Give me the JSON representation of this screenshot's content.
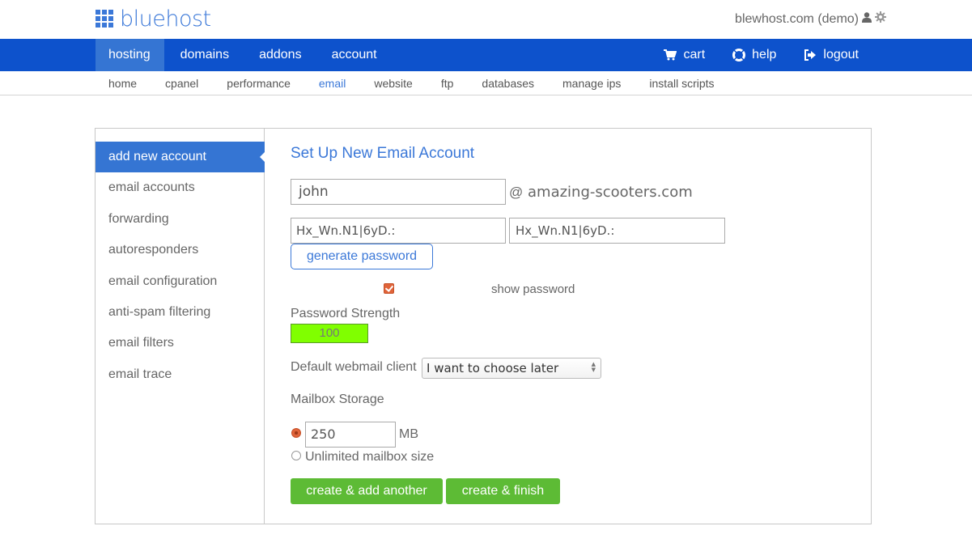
{
  "header": {
    "logo_text": "bluehost",
    "account_label": "blewhost.com (demo)",
    "icons": [
      "user-icon",
      "gear-icon"
    ]
  },
  "primary_nav": {
    "items": [
      {
        "label": "hosting",
        "active": true
      },
      {
        "label": "domains",
        "active": false
      },
      {
        "label": "addons",
        "active": false
      },
      {
        "label": "account",
        "active": false
      }
    ],
    "right_items": [
      {
        "label": "cart",
        "icon": "cart-icon"
      },
      {
        "label": "help",
        "icon": "lifebuoy-icon"
      },
      {
        "label": "logout",
        "icon": "logout-icon"
      }
    ]
  },
  "secondary_nav": {
    "items": [
      {
        "label": "home",
        "active": false
      },
      {
        "label": "cpanel",
        "active": false
      },
      {
        "label": "performance",
        "active": false
      },
      {
        "label": "email",
        "active": true
      },
      {
        "label": "website",
        "active": false
      },
      {
        "label": "ftp",
        "active": false
      },
      {
        "label": "databases",
        "active": false
      },
      {
        "label": "manage ips",
        "active": false
      },
      {
        "label": "install scripts",
        "active": false
      }
    ]
  },
  "sidebar": {
    "items": [
      {
        "label": "add new account",
        "active": true
      },
      {
        "label": "email accounts",
        "active": false
      },
      {
        "label": "forwarding",
        "active": false
      },
      {
        "label": "autoresponders",
        "active": false
      },
      {
        "label": "email configuration",
        "active": false
      },
      {
        "label": "anti-spam filtering",
        "active": false
      },
      {
        "label": "email filters",
        "active": false
      },
      {
        "label": "email trace",
        "active": false
      }
    ]
  },
  "form": {
    "title": "Set Up New Email Account",
    "email_user": "john",
    "at_sign": "@",
    "email_domain": "amazing-scooters.com",
    "password": "Hx_Wn.N1|6yD.:",
    "password_confirm": "Hx_Wn.N1|6yD.:",
    "generate_password_label": "generate password",
    "show_password_label": "show password",
    "show_password_checked": true,
    "password_strength_label": "Password Strength",
    "password_strength_value": "100",
    "password_strength_percent": 100,
    "strength_color": "#80ff00",
    "webmail_label": "Default webmail client",
    "webmail_selected": "I want to choose later",
    "mailbox_storage_label": "Mailbox Storage",
    "storage_quota": "250",
    "storage_unit": "MB",
    "storage_quota_selected": true,
    "unlimited_label": "Unlimited mailbox size",
    "unlimited_selected": false,
    "create_add_another_label": "create & add another",
    "create_finish_label": "create & finish"
  },
  "colors": {
    "brand_blue": "#0d52cc",
    "accent_blue": "#3575d3",
    "link_blue": "#3b78d8",
    "button_green": "#5dbb35",
    "checkbox_orange": "#e0643a"
  }
}
